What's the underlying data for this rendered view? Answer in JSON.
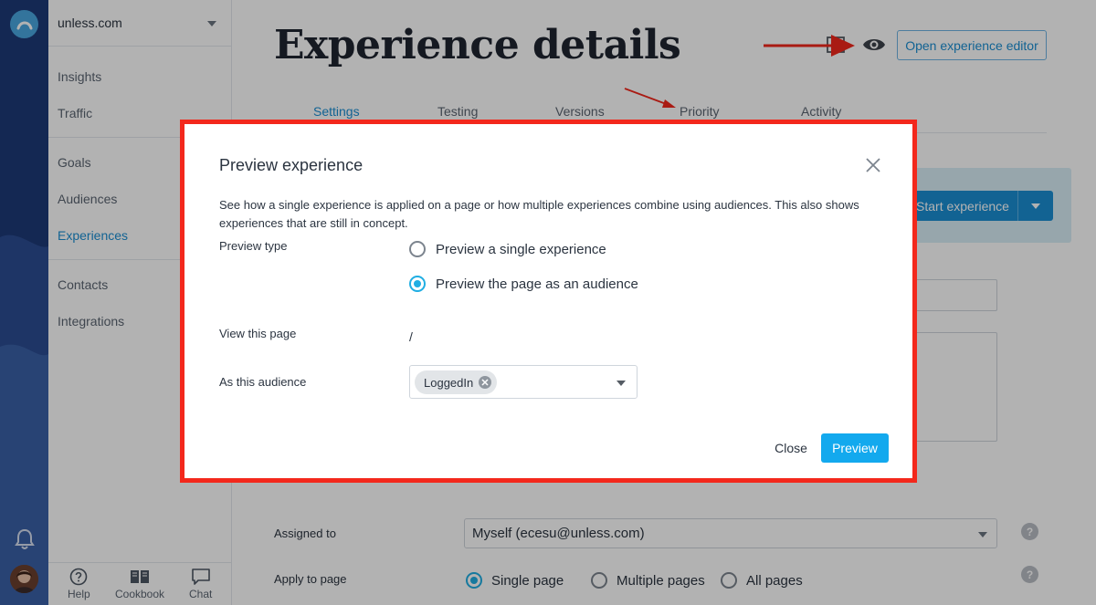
{
  "colors": {
    "accent": "#1a8ed3",
    "highlight": "#f3281c",
    "preview_button": "#13a9ee",
    "radio_on": "#20aee3"
  },
  "sidebar": {
    "site": "unless.com",
    "items": [
      {
        "label": "Insights"
      },
      {
        "label": "Traffic"
      },
      {
        "label": "Goals"
      },
      {
        "label": "Audiences"
      },
      {
        "label": "Experiences",
        "active": true
      },
      {
        "label": "Contacts"
      },
      {
        "label": "Integrations"
      }
    ],
    "footer": {
      "help": "Help",
      "cookbook": "Cookbook",
      "chat": "Chat"
    }
  },
  "header": {
    "title": "Experience details",
    "open_editor": "Open experience editor",
    "icons": [
      "layout-icon",
      "eye-icon"
    ]
  },
  "tabs": [
    {
      "label": "Settings",
      "active": true
    },
    {
      "label": "Testing"
    },
    {
      "label": "Versions"
    },
    {
      "label": "Priority"
    },
    {
      "label": "Activity"
    }
  ],
  "banner": {
    "start_button": "Start experience"
  },
  "form": {
    "assigned_label": "Assigned to",
    "assigned_value": "Myself (ecesu@unless.com)",
    "apply_label": "Apply to page",
    "apply_options": [
      {
        "label": "Single page",
        "selected": true
      },
      {
        "label": "Multiple pages",
        "selected": false
      },
      {
        "label": "All pages",
        "selected": false
      }
    ]
  },
  "modal": {
    "title": "Preview experience",
    "description": "See how a single experience is applied on a page or how multiple experiences combine using audiences. This also shows experiences that are still in concept.",
    "preview_type_label": "Preview type",
    "options": [
      {
        "label": "Preview a single experience",
        "selected": false
      },
      {
        "label": "Preview the page as an audience",
        "selected": true
      }
    ],
    "view_page_label": "View this page",
    "view_page_value": "/",
    "audience_label": "As this audience",
    "audience_chip": "LoggedIn",
    "close_label": "Close",
    "preview_label": "Preview"
  }
}
